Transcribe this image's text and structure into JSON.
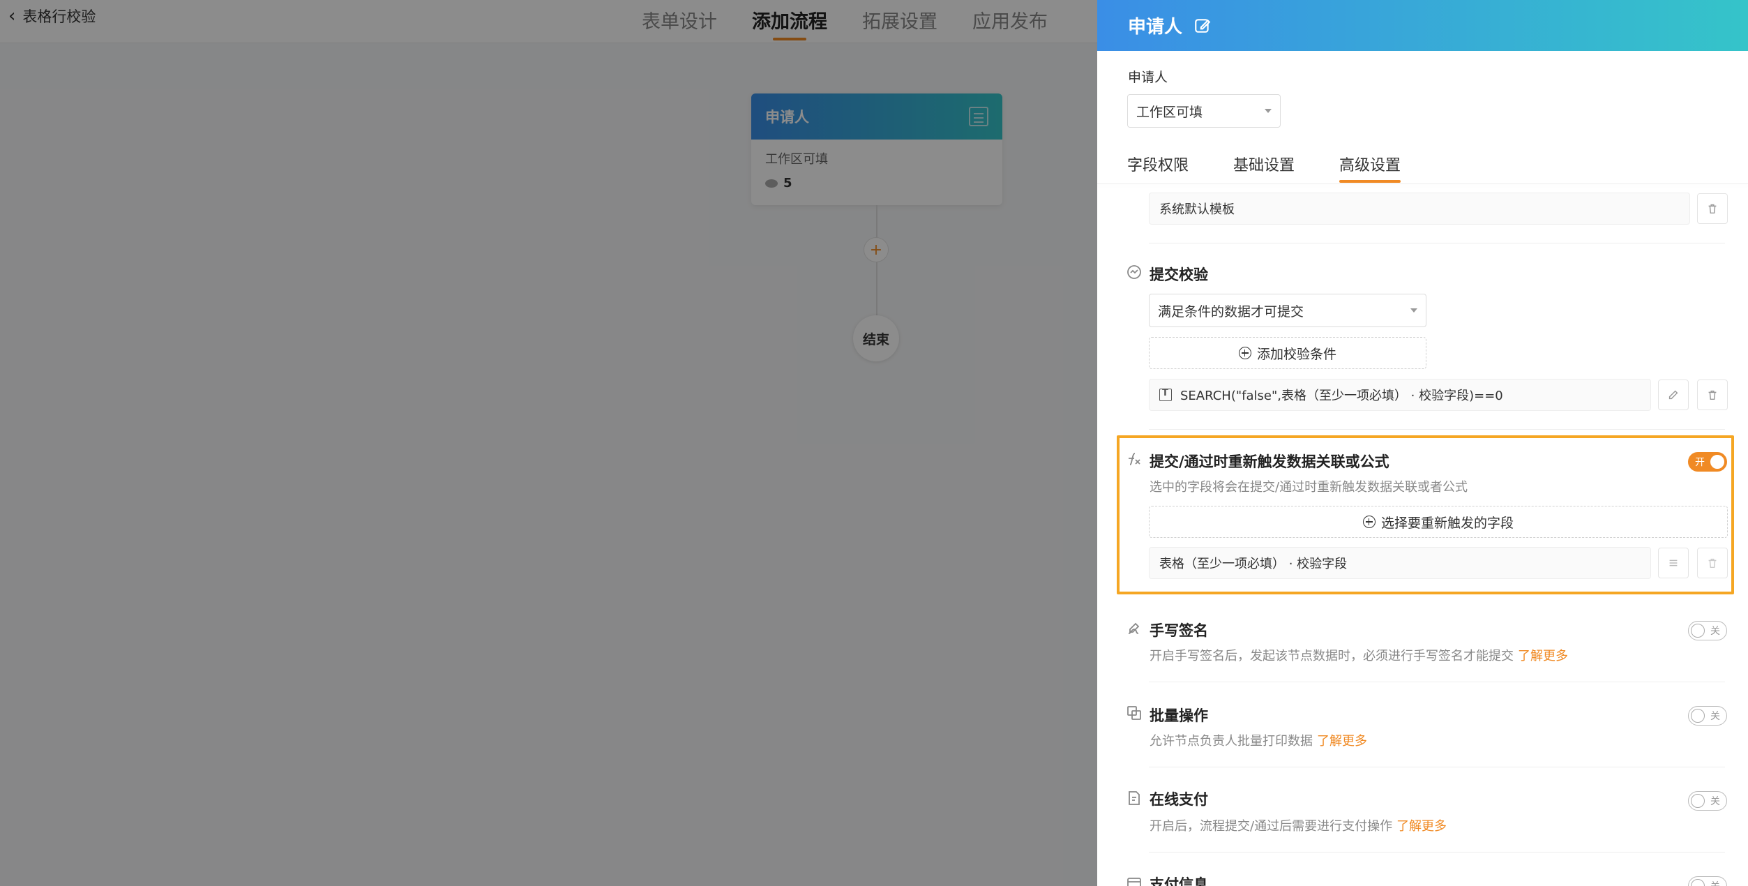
{
  "app": {
    "back_label": "表格行校验",
    "tabs": [
      "表单设计",
      "添加流程",
      "拓展设置",
      "应用发布"
    ],
    "active_tab": 1
  },
  "flow": {
    "node_title": "申请人",
    "node_scope": "工作区可填",
    "node_count": "5",
    "add_symbol": "+",
    "end_label": "结束"
  },
  "drawer": {
    "title": "申请人",
    "applicant_label": "申请人",
    "scope_value": "工作区可填",
    "sub_tabs": [
      "字段权限",
      "基础设置",
      "高级设置"
    ],
    "active_sub_tab": 2,
    "template_value": "系统默认模板",
    "validation": {
      "title": "提交校验",
      "select_value": "满足条件的数据才可提交",
      "add_condition_label": "添加校验条件",
      "condition_formula": "SEARCH(\"false\",表格（至少一项必填） · 校验字段)==0"
    },
    "retrigger": {
      "title": "提交/通过时重新触发数据关联或公式",
      "desc": "选中的字段将会在提交/通过时重新触发数据关联或者公式",
      "toggle_label": "开",
      "toggle_on": true,
      "select_fields_label": "选择要重新触发的字段",
      "field_value": "表格（至少一项必填） · 校验字段"
    },
    "signature": {
      "title": "手写签名",
      "desc": "开启手写签名后，发起该节点数据时，必须进行手写签名才能提交",
      "learn_more": "了解更多",
      "toggle_label": "关",
      "toggle_on": false
    },
    "batch": {
      "title": "批量操作",
      "desc": "允许节点负责人批量打印数据",
      "learn_more": "了解更多",
      "toggle_label": "关",
      "toggle_on": false
    },
    "payment": {
      "title": "在线支付",
      "desc": "开启后，流程提交/通过后需要进行支付操作",
      "learn_more": "了解更多",
      "toggle_label": "关",
      "toggle_on": false
    },
    "payinfo": {
      "title": "支付信息",
      "toggle_label": "关"
    }
  },
  "colors": {
    "accent": "#f08a24",
    "header_gradient_start": "#3a8ee6",
    "header_gradient_end": "#35c4c9",
    "highlight_border": "#f5a623"
  }
}
